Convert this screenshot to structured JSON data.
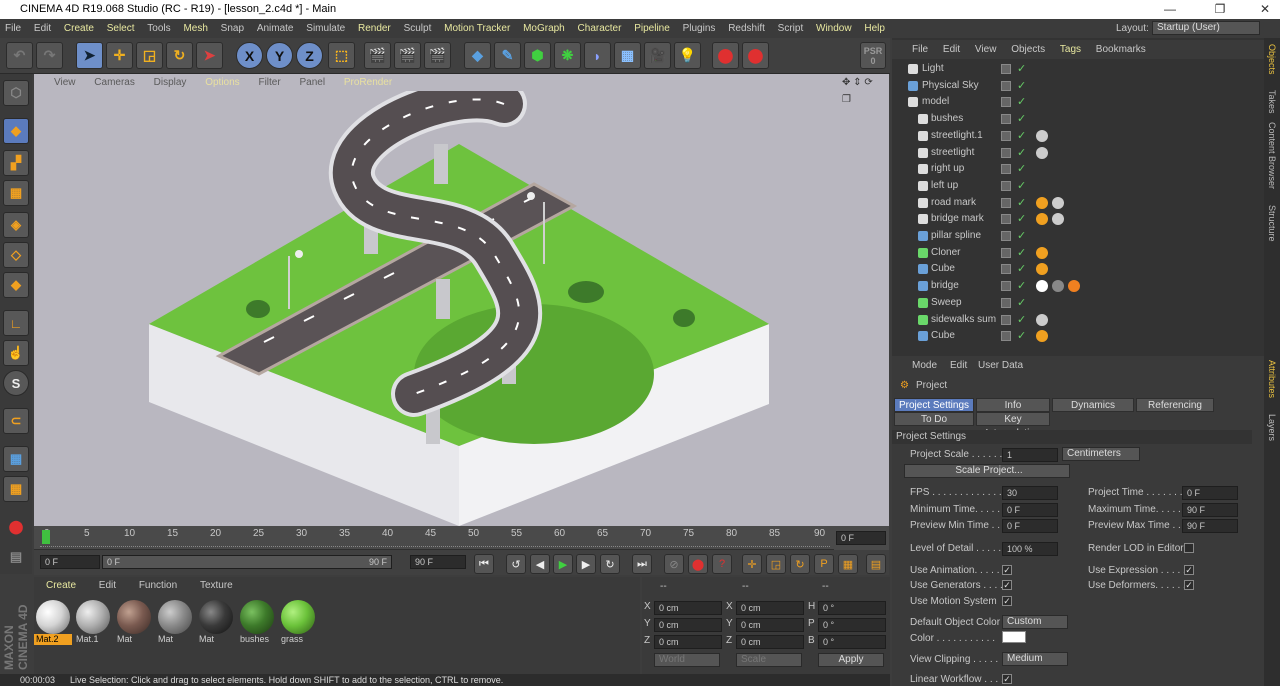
{
  "app_title": "CINEMA 4D R19.068 Studio (RC - R19) - [lesson_2.c4d *] - Main",
  "menu": [
    "File",
    "Edit",
    "Create",
    "Select",
    "Tools",
    "Mesh",
    "Snap",
    "Animate",
    "Simulate",
    "Render",
    "Sculpt",
    "Motion Tracker",
    "MoGraph",
    "Character",
    "Pipeline",
    "Plugins",
    "Redshift",
    "Script",
    "Window",
    "Help"
  ],
  "layout_label": "Layout:",
  "layout_value": "Startup (User)",
  "viewport_menu": [
    "View",
    "Cameras",
    "Display",
    "Options",
    "Filter",
    "Panel",
    "ProRender"
  ],
  "timeline_ticks": [
    "0",
    "5",
    "10",
    "15",
    "20",
    "25",
    "30",
    "35",
    "40",
    "45",
    "50",
    "55",
    "60",
    "65",
    "70",
    "75",
    "80",
    "85",
    "90"
  ],
  "timeline_frame": "0 F",
  "playbar": {
    "start": "0 F",
    "range_start": "0 F",
    "range_end": "90 F",
    "end": "90 F"
  },
  "material_menu": [
    "Create",
    "Edit",
    "Function",
    "Texture"
  ],
  "materials": [
    {
      "name": "Mat.2",
      "color": "#d4d4d4",
      "selected": true
    },
    {
      "name": "Mat.1",
      "color": "#b0b0b0"
    },
    {
      "name": "Mat",
      "color": "#7a5a50"
    },
    {
      "name": "Mat",
      "color": "#8a8a8a"
    },
    {
      "name": "Mat",
      "color": "#3a3a3a"
    },
    {
      "name": "bushes",
      "color": "#3d7a2a"
    },
    {
      "name": "grass",
      "color": "#6bc23a"
    }
  ],
  "coords": {
    "rows": [
      [
        "X",
        "0 cm",
        "X",
        "0 cm",
        "H",
        "0 °"
      ],
      [
        "Y",
        "0 cm",
        "Y",
        "0 cm",
        "P",
        "0 °"
      ],
      [
        "Z",
        "0 cm",
        "Z",
        "0 cm",
        "B",
        "0 °"
      ]
    ],
    "mode1": "World",
    "mode2": "Scale",
    "apply": "Apply",
    "header1": "--",
    "header2": "--",
    "header3": "--"
  },
  "object_menu": [
    "File",
    "Edit",
    "View",
    "Objects",
    "Tags",
    "Bookmarks"
  ],
  "objects": [
    {
      "name": "Light",
      "indent": 0,
      "color": "#ddd"
    },
    {
      "name": "Physical Sky",
      "indent": 0,
      "color": "#6aa0d8"
    },
    {
      "name": "model",
      "indent": 0,
      "color": "#ddd"
    },
    {
      "name": "bushes",
      "indent": 1,
      "color": "#ddd"
    },
    {
      "name": "streetlight.1",
      "indent": 1,
      "color": "#ddd"
    },
    {
      "name": "streetlight",
      "indent": 1,
      "color": "#ddd"
    },
    {
      "name": "right up",
      "indent": 1,
      "color": "#ddd"
    },
    {
      "name": "left up",
      "indent": 1,
      "color": "#ddd"
    },
    {
      "name": "road mark",
      "indent": 1,
      "color": "#ddd"
    },
    {
      "name": "bridge mark",
      "indent": 1,
      "color": "#ddd"
    },
    {
      "name": "pillar spline",
      "indent": 1,
      "color": "#6aa0d8"
    },
    {
      "name": "Cloner",
      "indent": 1,
      "color": "#6ad86a"
    },
    {
      "name": "Cube",
      "indent": 1,
      "color": "#6aa0d8"
    },
    {
      "name": "bridge",
      "indent": 1,
      "color": "#6aa0d8"
    },
    {
      "name": "Sweep",
      "indent": 1,
      "color": "#6ad86a"
    },
    {
      "name": "sidewalks sum",
      "indent": 1,
      "color": "#6ad86a"
    },
    {
      "name": "Cube",
      "indent": 1,
      "color": "#6aa0d8"
    }
  ],
  "attr_menu": [
    "Mode",
    "Edit",
    "User Data"
  ],
  "attr": {
    "title": "Project",
    "tabs": [
      "Project Settings",
      "Info",
      "Dynamics",
      "Referencing",
      "To Do",
      "Key Interpolation"
    ],
    "section": "Project Settings",
    "project_scale_label": "Project Scale . . . . . .",
    "project_scale": "1",
    "unit": "Centimeters",
    "scale_project": "Scale Project...",
    "fps_label": "FPS . . . . . . . . . . . . .",
    "fps": "30",
    "project_time_label": "Project Time . . . . . . .",
    "project_time": "0 F",
    "min_time_label": "Minimum Time. . . . . . .",
    "min_time": "0 F",
    "max_time_label": "Maximum Time. . . . . . .",
    "max_time": "90 F",
    "prev_min_label": "Preview Min Time . . .",
    "prev_min": "0 F",
    "prev_max_label": "Preview Max Time . . .",
    "prev_max": "90 F",
    "lod_label": "Level of Detail . . . . . .",
    "lod": "100 %",
    "render_lod_label": "Render LOD in Editor",
    "use_anim": "Use Animation. . . . . .",
    "use_expr": "Use Expression . . . . .",
    "use_gen": "Use Generators . . . . .",
    "use_def": "Use Deformers. . . . . .",
    "use_motion": "Use Motion System",
    "def_color_label": "Default Object Color",
    "def_color": "Custom",
    "color_label": "Color . . . . . . . . . . .",
    "view_clip_label": "View Clipping . . . . .",
    "view_clip": "Medium",
    "linear_wf": "Linear Workflow . . . ."
  },
  "side_tabs": [
    "Objects",
    "Takes",
    "Content Browser",
    "Structure",
    "Attributes",
    "Layers"
  ],
  "status": {
    "time": "00:00:03",
    "message": "Live Selection: Click and drag to select elements. Hold down SHIFT to add to the selection, CTRL to remove."
  },
  "psr_label": "PSR",
  "psr_value": "0"
}
